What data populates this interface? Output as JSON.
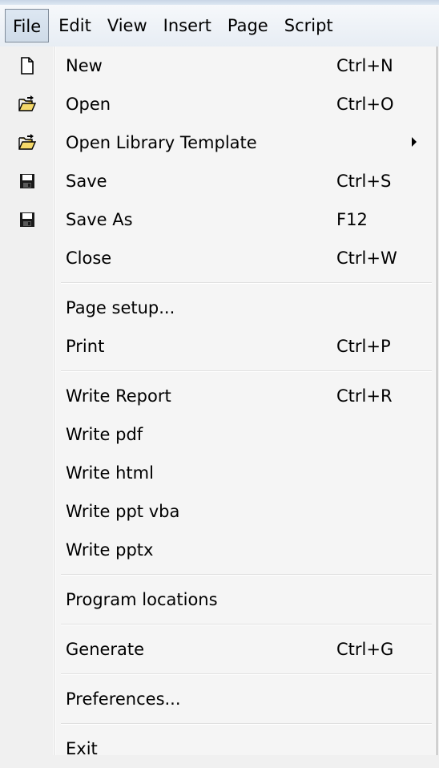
{
  "menubar": {
    "items": [
      "File",
      "Edit",
      "View",
      "Insert",
      "Page",
      "Script"
    ]
  },
  "file_menu": {
    "new": {
      "label": "New",
      "shortcut": "Ctrl+N",
      "icon": "new-document-icon"
    },
    "open": {
      "label": "Open",
      "shortcut": "Ctrl+O",
      "icon": "open-folder-icon"
    },
    "open_library_template": {
      "label": "Open Library Template",
      "icon": "open-folder-icon",
      "submenu": true
    },
    "save": {
      "label": "Save",
      "shortcut": "Ctrl+S",
      "icon": "save-disk-icon"
    },
    "save_as": {
      "label": "Save As",
      "shortcut": "F12",
      "icon": "save-disk-icon"
    },
    "close": {
      "label": "Close",
      "shortcut": "Ctrl+W"
    },
    "page_setup": {
      "label": "Page setup..."
    },
    "print": {
      "label": "Print",
      "shortcut": "Ctrl+P"
    },
    "write_report": {
      "label": "Write Report",
      "shortcut": "Ctrl+R"
    },
    "write_pdf": {
      "label": "Write pdf"
    },
    "write_html": {
      "label": "Write html"
    },
    "write_ppt_vba": {
      "label": "Write ppt vba"
    },
    "write_pptx": {
      "label": "Write pptx"
    },
    "program_locations": {
      "label": "Program locations"
    },
    "generate": {
      "label": "Generate",
      "shortcut": "Ctrl+G"
    },
    "preferences": {
      "label": "Preferences..."
    },
    "exit": {
      "label": "Exit"
    }
  }
}
